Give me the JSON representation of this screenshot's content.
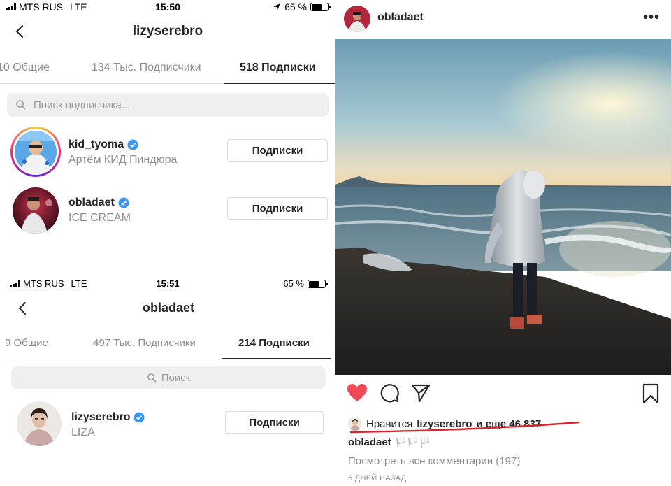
{
  "panel_a": {
    "status": {
      "carrier": "MTS RUS",
      "network": "LTE",
      "time": "15:50",
      "battery": "65 %",
      "battery_level": 0.65
    },
    "title": "lizyserebro",
    "tabs": [
      "10 Общие",
      "134 Тыс. Подписчики",
      "518 Подписки"
    ],
    "active_tab": 2,
    "search_placeholder": "Поиск подписчика...",
    "rows": [
      {
        "username": "kid_tyoma",
        "subtitle": "Артём КИД Пиндюра",
        "button": "Подписки",
        "verified": true,
        "story_ring": true
      },
      {
        "username": "obladaet",
        "subtitle": "ICE CREAM",
        "button": "Подписки",
        "verified": true,
        "story_ring": false
      }
    ]
  },
  "panel_b": {
    "status": {
      "carrier": "MTS RUS",
      "network": "LTE",
      "time": "15:51",
      "battery": "65 %",
      "battery_level": 0.65
    },
    "title": "obladaet",
    "tabs": [
      "9 Общие",
      "497 Тыс. Подписчики",
      "214 Подписки"
    ],
    "active_tab": 2,
    "search_placeholder": "Поиск",
    "rows": [
      {
        "username": "lizyserebro",
        "subtitle": "LIZA",
        "button": "Подписки",
        "verified": true
      }
    ]
  },
  "post": {
    "username": "obladaet",
    "likes_prefix": "Нравится",
    "likes_user": "lizyserebro",
    "likes_suffix": "и еще 46 837",
    "caption_user": "obladaet",
    "caption_emoji": "🏳️🏳️🏳️",
    "comments_link": "Посмотреть все комментарии (197)",
    "date": "6 ДНЕЙ НАЗАД",
    "liked": true
  },
  "colors": {
    "verified": "#3897f0",
    "like_red": "#ed4956",
    "annotation_red": "#d9252a",
    "muted": "#8e8e8e"
  }
}
